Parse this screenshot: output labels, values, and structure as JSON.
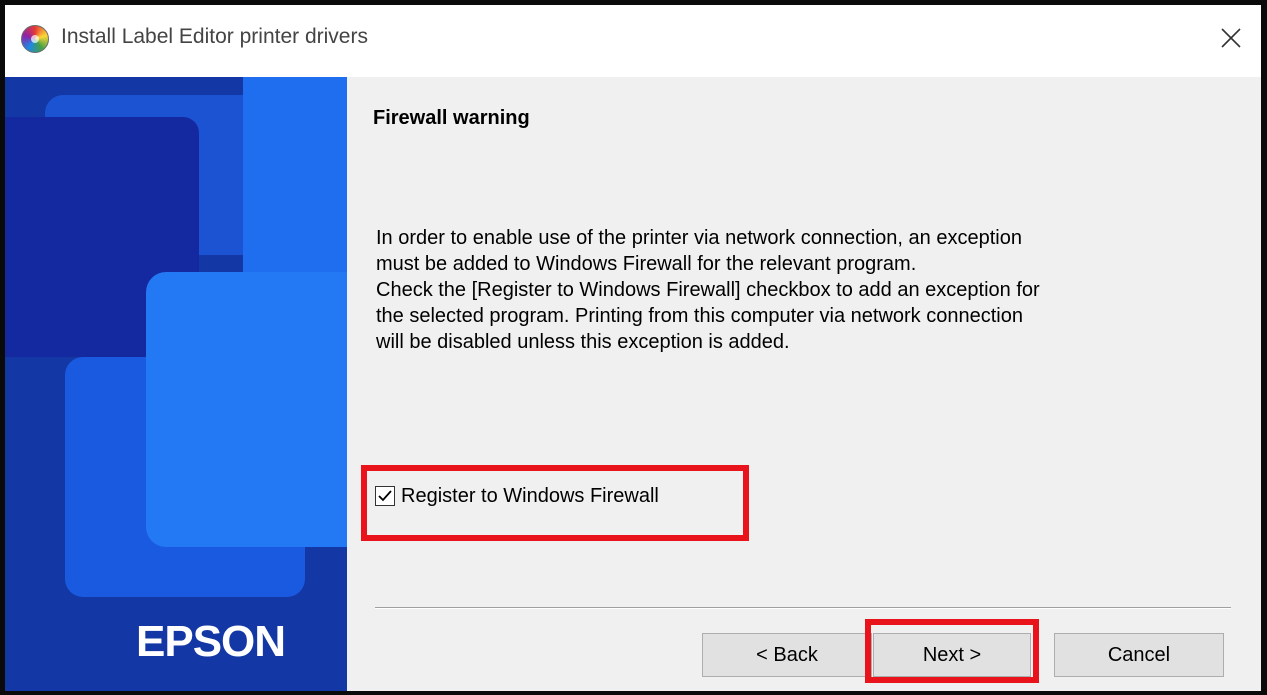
{
  "window": {
    "title": "Install Label Editor printer drivers",
    "close_icon": "close-icon"
  },
  "sidebar": {
    "brand": "EPSON"
  },
  "content": {
    "heading": "Firewall warning",
    "paragraph_lines": [
      "In order to enable use of the printer via network connection, an exception",
      "must be added to Windows Firewall for the relevant program.",
      "Check the [Register to Windows Firewall] checkbox to add an exception for",
      "the selected program. Printing from this computer via network connection",
      "will be disabled unless this exception is added."
    ],
    "checkbox": {
      "label": "Register to Windows Firewall",
      "checked": true
    }
  },
  "buttons": {
    "back": "< Back",
    "next": "Next >",
    "cancel": "Cancel"
  },
  "colors": {
    "highlight": "#e8131b",
    "sidebar_blue": "#1337a4"
  }
}
